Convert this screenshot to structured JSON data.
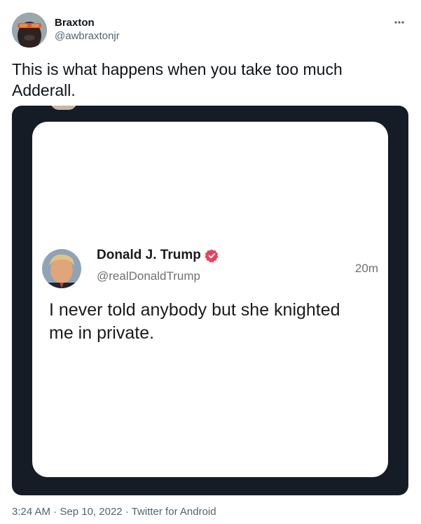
{
  "author": {
    "display_name": "Braxton",
    "handle": "@awbraxtonjr"
  },
  "tweet": {
    "text": "This is what happens when you take too much Adderall."
  },
  "media": {
    "embedded_tweet": {
      "display_name": "Donald J. Trump",
      "handle": "@realDonaldTrump",
      "time": "20m",
      "text": "I never told anybody but she knighted me in private.",
      "verified_color": "#e8425a"
    }
  },
  "meta": {
    "time": "3:24 AM",
    "date": "Sep 10, 2022",
    "source": "Twitter for Android",
    "separator": "·"
  },
  "icons": {
    "more": "more-horizontal-icon",
    "verified": "verified-badge-icon"
  }
}
